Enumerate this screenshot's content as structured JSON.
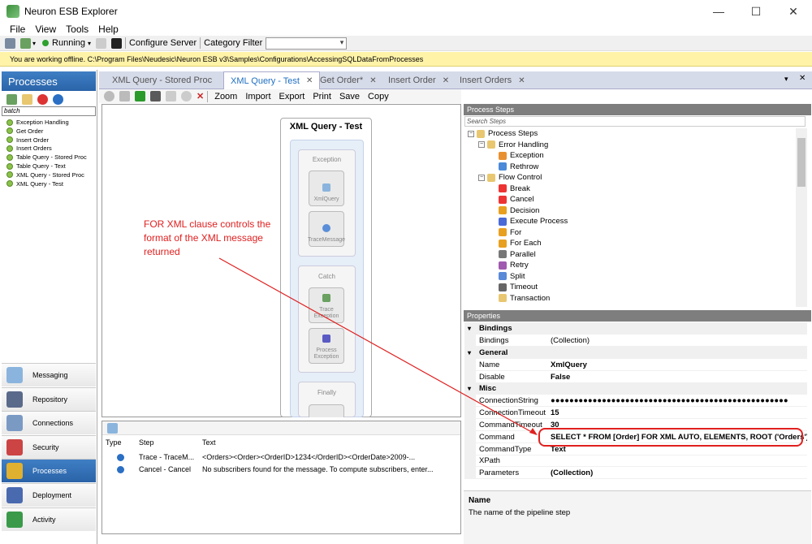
{
  "window": {
    "title": "Neuron ESB Explorer"
  },
  "menu": [
    "File",
    "View",
    "Tools",
    "Help"
  ],
  "toolbar": {
    "status": "Running",
    "configure": "Configure Server",
    "category_filter": "Category Filter",
    "category_value": ""
  },
  "infobar": {
    "text": "You are working offline.  C:\\Program Files\\Neudesic\\Neuron ESB v3\\Samples\\Configurations\\AccessingSQLDataFromProcesses"
  },
  "left": {
    "header": "Processes",
    "search": "batch",
    "processes": [
      "Exception Handling",
      "Get Order",
      "Insert Order",
      "Insert Orders",
      "Table Query - Stored Proc",
      "Table Query - Text",
      "XML Query - Stored Proc",
      "XML Query - Test"
    ],
    "nav": [
      "Messaging",
      "Repository",
      "Connections",
      "Security",
      "Processes",
      "Deployment",
      "Activity"
    ],
    "nav_selected": "Processes"
  },
  "tabs": [
    {
      "label": "XML Query - Stored Proc",
      "active": false
    },
    {
      "label": "XML Query - Test",
      "active": true
    },
    {
      "label": "Get Order*",
      "active": false
    },
    {
      "label": "Insert Order",
      "active": false
    },
    {
      "label": "Insert Orders",
      "active": false
    }
  ],
  "editor_toolbar": {
    "zoom": "Zoom",
    "import": "Import",
    "export": "Export",
    "print": "Print",
    "save": "Save",
    "copy": "Copy"
  },
  "designer": {
    "title": "XML Query - Test",
    "blocks": [
      {
        "label": "Exception",
        "steps": [
          "XmlQuery",
          "TraceMessage"
        ]
      },
      {
        "label": "Catch",
        "steps": [
          "Trace Exception",
          "Process Exception"
        ]
      },
      {
        "label": "Finally",
        "steps": []
      }
    ]
  },
  "annotation": "FOR XML clause controls the format of the XML message returned",
  "log": {
    "columns": [
      "Type",
      "Step",
      "Text"
    ],
    "rows": [
      {
        "step": "Trace - TraceM...",
        "text": "<Orders><Order><OrderID>1234</OrderID><OrderDate>2009-..."
      },
      {
        "step": "Cancel - Cancel",
        "text": "No subscribers found for the message. To compute subscribers, enter..."
      }
    ]
  },
  "process_steps": {
    "header": "Process Steps",
    "search": "Search Steps",
    "root": "Process Steps",
    "groups": [
      {
        "name": "Error Handling",
        "items": [
          "Exception",
          "Rethrow"
        ]
      },
      {
        "name": "Flow Control",
        "items": [
          "Break",
          "Cancel",
          "Decision",
          "Execute Process",
          "For",
          "For Each",
          "Parallel",
          "Retry",
          "Split",
          "Timeout",
          "Transaction"
        ]
      }
    ]
  },
  "properties": {
    "header": "Properties",
    "categories": [
      {
        "name": "Bindings",
        "props": [
          {
            "k": "Bindings",
            "v": "(Collection)",
            "bold": false
          }
        ]
      },
      {
        "name": "General",
        "props": [
          {
            "k": "Name",
            "v": "XmlQuery",
            "bold": true
          },
          {
            "k": "Disable",
            "v": "False",
            "bold": true
          }
        ]
      },
      {
        "name": "Misc",
        "props": [
          {
            "k": "ConnectionString",
            "v": "●●●●●●●●●●●●●●●●●●●●●●●●●●●●●●●●●●●●●●●●●●●●●●●●●●●",
            "bold": true
          },
          {
            "k": "ConnectionTimeout",
            "v": "15",
            "bold": true
          },
          {
            "k": "CommandTimeout",
            "v": "30",
            "bold": true
          },
          {
            "k": "Command",
            "v": "SELECT * FROM [Order] FOR XML AUTO, ELEMENTS, ROOT ('Orders')",
            "bold": true
          },
          {
            "k": "CommandType",
            "v": "Text",
            "bold": true
          },
          {
            "k": "XPath",
            "v": "",
            "bold": false
          },
          {
            "k": "Parameters",
            "v": "(Collection)",
            "bold": true
          }
        ]
      }
    ],
    "description": {
      "title": "Name",
      "text": "The name of the pipeline step"
    }
  }
}
